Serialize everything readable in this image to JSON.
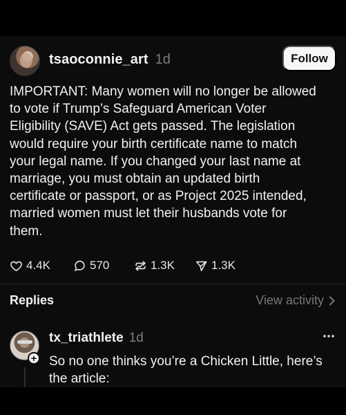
{
  "post": {
    "username": "tsaoconnie_art",
    "time": "1d",
    "follow_label": "Follow",
    "text": "IMPORTANT: Many women will no longer be allowed\nto vote if Trump’s Safeguard American Voter\nEligibility (SAVE) Act gets passed. The legislation\nwould require your birth certificate name to match\nyour legal name. If you changed your last name at\nmarriage, you must obtain an updated birth\ncertificate or passport, or as Project 2025 intended,\nmarried women must let their husbands vote for\nthem.",
    "stats": {
      "likes": "4.4K",
      "comments": "570",
      "reposts": "1.3K",
      "shares": "1.3K"
    }
  },
  "replies_section": {
    "label": "Replies",
    "view_activity": "View activity"
  },
  "reply": {
    "username": "tx_triathlete",
    "time": "1d",
    "text": "So no one thinks you’re a Chicken Little, here’s\nthe article:"
  },
  "icons": {
    "like": "heart-icon",
    "comment": "comment-icon",
    "repost": "repost-icon",
    "share": "share-icon",
    "more": "more-horizontal-icon",
    "chevron": "chevron-right-icon",
    "add": "plus-icon"
  },
  "colors": {
    "background": "#000000",
    "panel": "#0c0c0c",
    "text": "#f2f2f2",
    "muted": "#7d7d7d",
    "button": "#f7f7f7"
  }
}
